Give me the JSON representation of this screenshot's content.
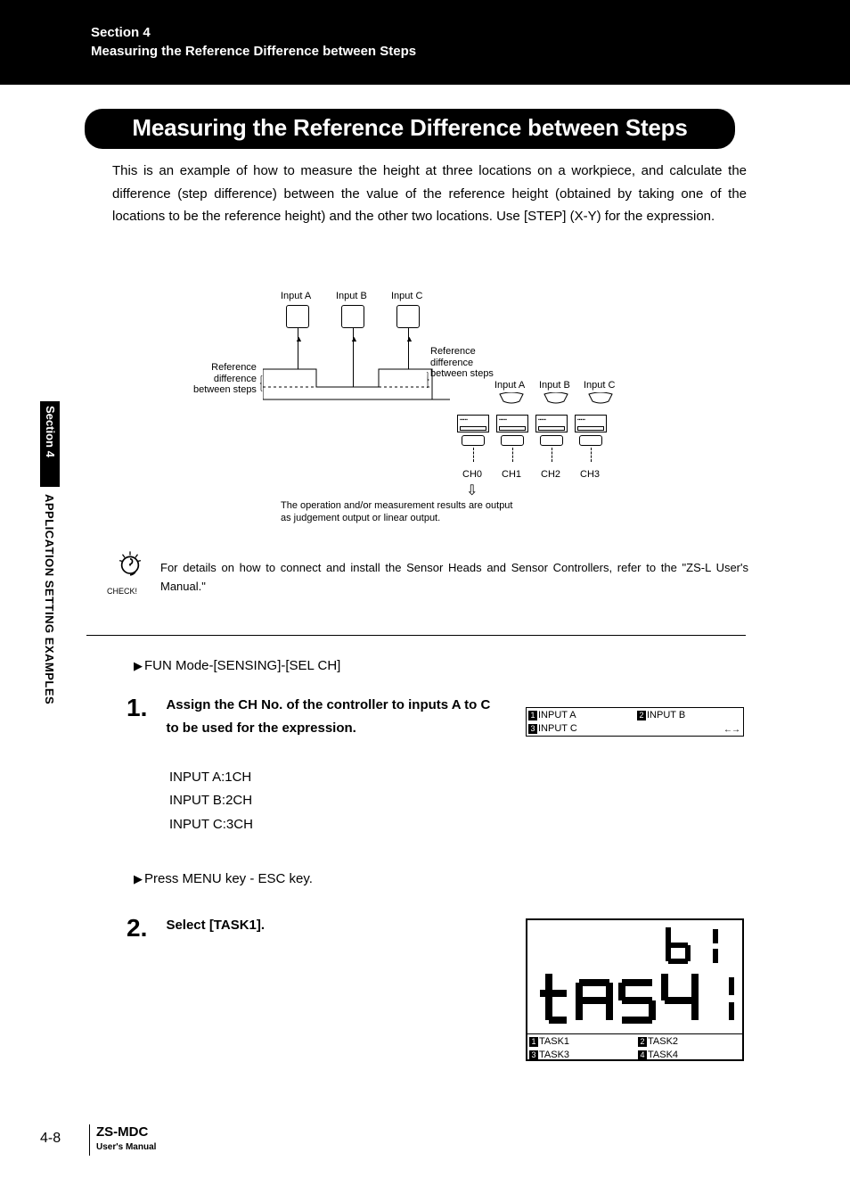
{
  "header": {
    "section_label": "Section 4",
    "section_title": "Measuring the Reference Difference between Steps"
  },
  "title": "Measuring the Reference Difference between Steps",
  "intro": "This is an example of how to measure the height at three locations on a workpiece, and calculate the difference (step difference) between the value of the reference height (obtained by taking one of the locations to be the reference height) and the other two locations. Use [STEP] (X-Y) for the expression.",
  "diagram": {
    "input_labels": [
      "Input A",
      "Input B",
      "Input C"
    ],
    "ref_label_left": "Reference\ndifference\nbetween steps",
    "ref_label_right": "Reference\ndifference\nbetween steps",
    "controller_inputs": [
      "Input A",
      "Input B",
      "Input C"
    ],
    "channels": [
      "CH0",
      "CH1",
      "CH2",
      "CH3"
    ],
    "output_text": "The operation and/or measurement results are output\nas judgement output or linear output."
  },
  "check": {
    "label": "CHECK!",
    "text": "For details on how to connect and install the Sensor Heads and Sensor Controllers, refer to the \"ZS-L User's Manual.\""
  },
  "procedure": {
    "line1": "FUN Mode-[SENSING]-[SEL CH]",
    "step1": {
      "num": "1.",
      "text": "Assign the CH No. of the controller to inputs A to C to be used for the expression.",
      "assignments": [
        "INPUT A:1CH",
        "INPUT B:2CH",
        "INPUT C:3CH"
      ]
    },
    "line2": "Press MENU key - ESC key.",
    "step2": {
      "num": "2.",
      "text": "Select [TASK1]."
    }
  },
  "mini_screen": {
    "items": [
      {
        "n": "1",
        "label": "INPUT A"
      },
      {
        "n": "2",
        "label": "INPUT B"
      },
      {
        "n": "3",
        "label": "INPUT C"
      }
    ],
    "arrows": "←→"
  },
  "seg_panel": {
    "upper_hint": "b",
    "main_text": "tASk",
    "tasks": [
      {
        "n": "1",
        "label": "TASK1"
      },
      {
        "n": "2",
        "label": "TASK2"
      },
      {
        "n": "3",
        "label": "TASK3"
      },
      {
        "n": "4",
        "label": "TASK4"
      }
    ]
  },
  "side": {
    "black": "Section 4",
    "rest": "APPLICATION SETTING EXAMPLES"
  },
  "footer": {
    "page": "4-8",
    "model": "ZS-MDC",
    "sub": "User's Manual"
  }
}
